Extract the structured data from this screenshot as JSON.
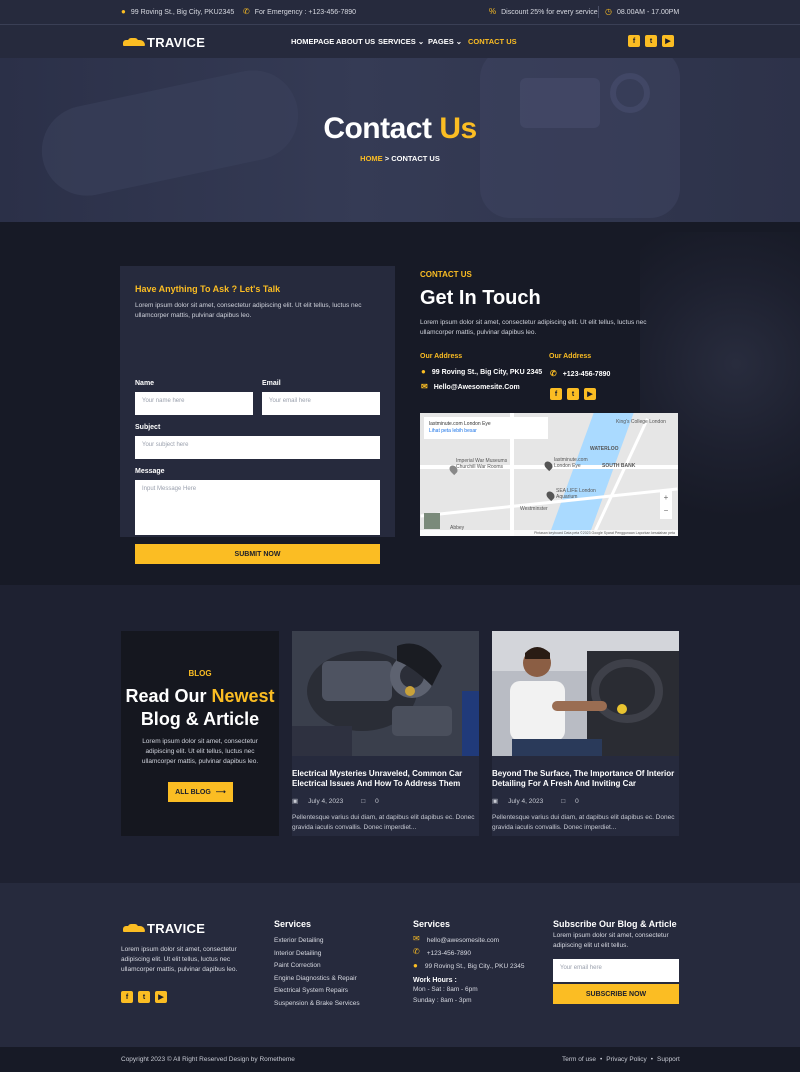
{
  "topbar": {
    "address": "99 Roving St., Big City, PKU2345",
    "emergency": "For Emergency : +123-456-7890",
    "discount": "Discount 25% for every service",
    "hours": "08.00AM - 17.00PM"
  },
  "brand": {
    "name": "TRAVICE"
  },
  "nav": {
    "items": [
      "HOMEPAGE",
      "ABOUT US",
      "SERVICES",
      "PAGES",
      "CONTACT US"
    ],
    "active": "CONTACT US"
  },
  "social": [
    "facebook-icon",
    "twitter-icon",
    "youtube-icon"
  ],
  "hero": {
    "title_a": "Contact",
    "title_b": "Us",
    "crumb_home": "HOME",
    "crumb_sep": ">",
    "crumb_current": "CONTACT US"
  },
  "form": {
    "title": "Have Anything To Ask ? Let's Talk",
    "desc": "Lorem ipsum dolor sit amet, consectetur adipiscing elit. Ut elit tellus, luctus nec ullamcorper mattis, pulvinar dapibus leo.",
    "name_label": "Name",
    "name_placeholder": "Your name here",
    "email_label": "Email",
    "email_placeholder": "Your email here",
    "subject_label": "Subject",
    "subject_placeholder": "Your subject here",
    "message_label": "Message",
    "message_placeholder": "Input Message Here",
    "submit": "SUBMIT NOW"
  },
  "contact": {
    "subtitle": "CONTACT US",
    "title": "Get In Touch",
    "desc": "Lorem ipsum dolor sit amet, consectetur adipiscing elit. Ut elit tellus, luctus nec ullamcorper mattis, pulvinar dapibus leo.",
    "addr_heading": "Our Address",
    "address": "99 Roving St., Big City, PKU 2345",
    "email": "Hello@Awesomesite.Com",
    "addr_heading2": "Our Address",
    "phone": "+123-456-7890"
  },
  "map": {
    "place": "lastminute.com London Eye",
    "link": "Lihat peta lebih besar",
    "labels": [
      "King's College London",
      "WATERLOO",
      "SOUTH BANK",
      "Imperial War Museums Churchill War Rooms",
      "SEA LIFE London Aquarium",
      "lastminute.com London Eye",
      "Westminster",
      "Abbey"
    ],
    "footer": "Pintasan keyboard   Data peta ©2023 Google   Syarat Penggunaan   Laporkan kesalahan peta"
  },
  "blog": {
    "tag": "BLOG",
    "title_a": "Read Our",
    "title_b": "Newest",
    "title_c": "Blog & Article",
    "desc": "Lorem ipsum dolor sit amet, consectetur adipiscing elit. Ut elit tellus, luctus nec ullamcorper mattis, pulvinar dapibus leo.",
    "button": "ALL BLOG",
    "posts": [
      {
        "title": "Electrical Mysteries Unraveled, Common Car Electrical Issues And How To Address Them",
        "date": "July 4, 2023",
        "comments": "0",
        "excerpt": "Pellentesque varius dui diam, at dapibus elit dapibus ec. Donec gravida iaculis convallis. Donec imperdiet..."
      },
      {
        "title": "Beyond The Surface, The Importance Of Interior Detailing For A Fresh And Inviting Car",
        "date": "July 4, 2023",
        "comments": "0",
        "excerpt": "Pellentesque varius dui diam, at dapibus elit dapibus ec. Donec gravida iaculis convallis. Donec imperdiet..."
      }
    ]
  },
  "footer": {
    "about": "Lorem ipsum dolor sit amet, consectetur adipiscing elit. Ut elit tellus, luctus nec ullamcorper mattis, pulvinar dapibus leo.",
    "services_title": "Services",
    "services": [
      "Exterior Detailing",
      "Interior Detailing",
      "Paint Correction",
      "Engine Diagnostics & Repair",
      "Electrical System Repairs",
      "Suspension & Brake Services"
    ],
    "contact_title": "Services",
    "email": "hello@awesomesite.com",
    "phone": "+123-456-7890",
    "address": "99 Roving St., Big City., PKU 2345",
    "hours_title": "Work Hours :",
    "hours1": "Mon - Sat : 8am - 6pm",
    "hours2": "Sunday : 8am - 3pm",
    "subscribe_title": "Subscribe Our Blog & Article",
    "subscribe_desc": "Lorem ipsum dolor sit amet, consectetur adipiscing elit ut elit tellus.",
    "subscribe_placeholder": "Your email here",
    "subscribe_button": "SUBSCRIBE NOW"
  },
  "bottom": {
    "copyright": "Copyright 2023 © All Right Reserved Design by Rometheme",
    "links": [
      "Term of use",
      "Privacy Policy",
      "Support"
    ]
  },
  "colors": {
    "accent": "#fbbd23",
    "dark": "#171a26",
    "panel": "#262a3d"
  }
}
